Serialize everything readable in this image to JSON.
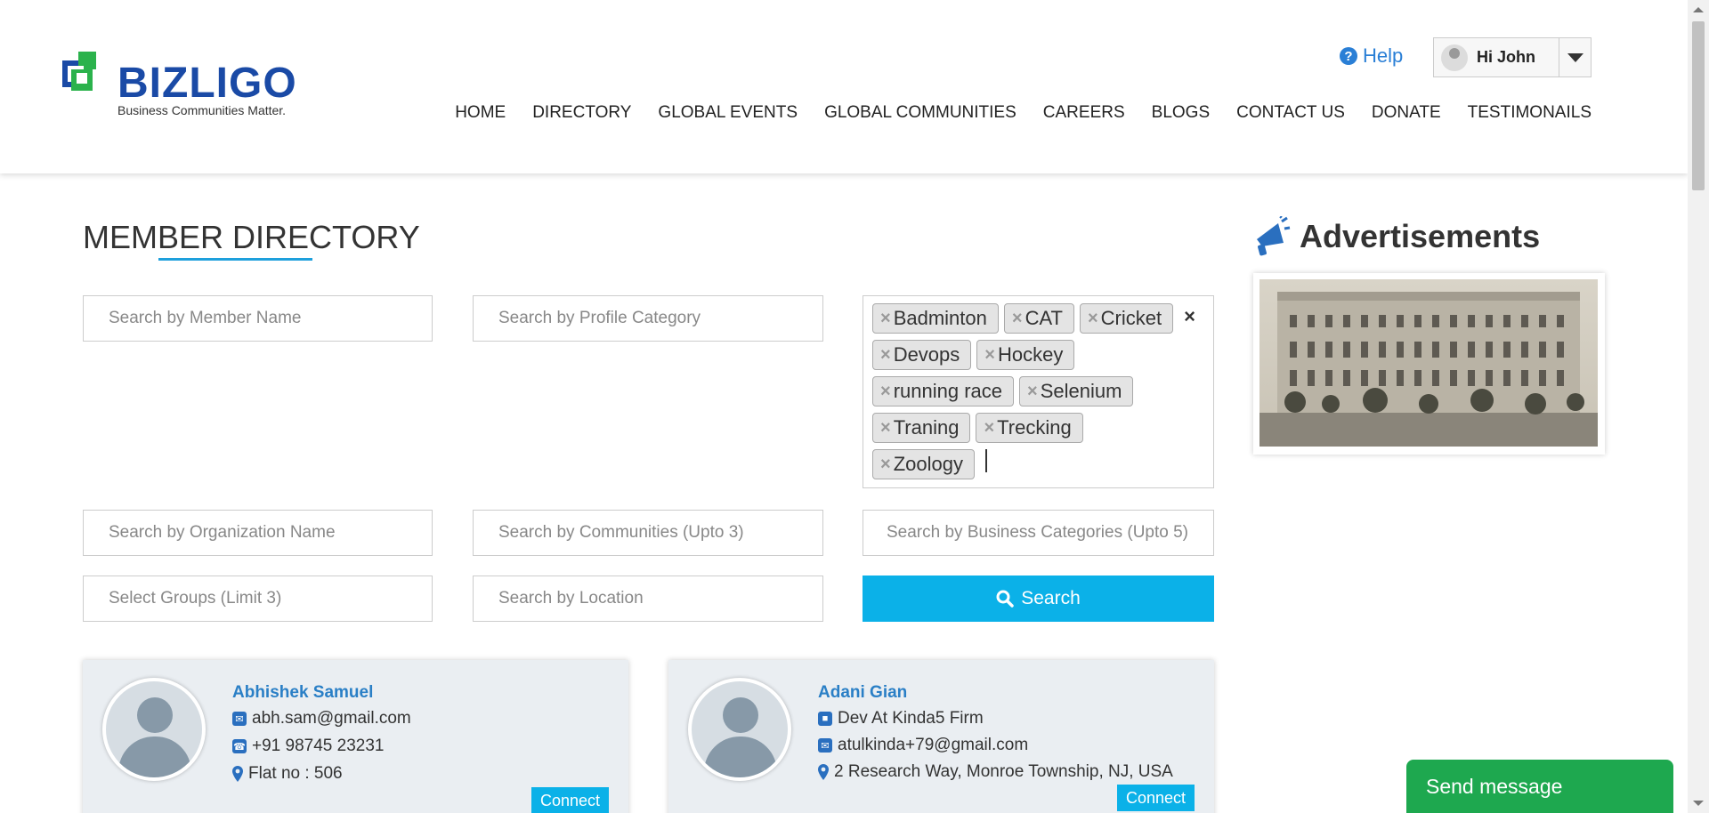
{
  "header": {
    "logo_text": "BIZLIGO",
    "logo_tagline": "Business Communities Matter.",
    "help_label": "Help",
    "user_greeting": "Hi John",
    "nav": [
      "HOME",
      "DIRECTORY",
      "GLOBAL EVENTS",
      "GLOBAL COMMUNITIES",
      "CAREERS",
      "BLOGS",
      "CONTACT US",
      "DONATE",
      "TESTIMONAILS"
    ]
  },
  "page_title": "MEMBER DIRECTORY",
  "filters": {
    "member_name_placeholder": "Search by Member Name",
    "profile_category_placeholder": "Search by Profile Category",
    "organization_placeholder": "Search by Organization Name",
    "communities_placeholder": "Search by Communities (Upto 3)",
    "business_categories_placeholder": "Search by Business Categories (Upto 5)",
    "groups_placeholder": "Select Groups (Limit 3)",
    "location_placeholder": "Search by Location",
    "search_label": "Search",
    "selected_tags": [
      "Badminton",
      "CAT",
      "Cricket",
      "Devops",
      "Hockey",
      "running race",
      "Selenium",
      "Traning",
      "Trecking",
      "Zoology"
    ],
    "tag_remove_glyph": "×",
    "clear_glyph": "×"
  },
  "members": [
    {
      "name": "Abhishek Samuel",
      "email": "abh.sam@gmail.com",
      "phone": "+91 98745 23231",
      "address": "Flat no : 506",
      "connect_label": "Connect"
    },
    {
      "name": "Adani Gian",
      "organization": "Dev At Kinda5 Firm",
      "email": "atulkinda+79@gmail.com",
      "address": "2 Research Way, Monroe Township, NJ, USA",
      "connect_label": "Connect"
    }
  ],
  "ads": {
    "title": "Advertisements"
  },
  "send_message_label": "Send message",
  "colors": {
    "accent": "#0bb1e8",
    "link": "#2a7fc6",
    "send_message": "#1ea84f"
  }
}
